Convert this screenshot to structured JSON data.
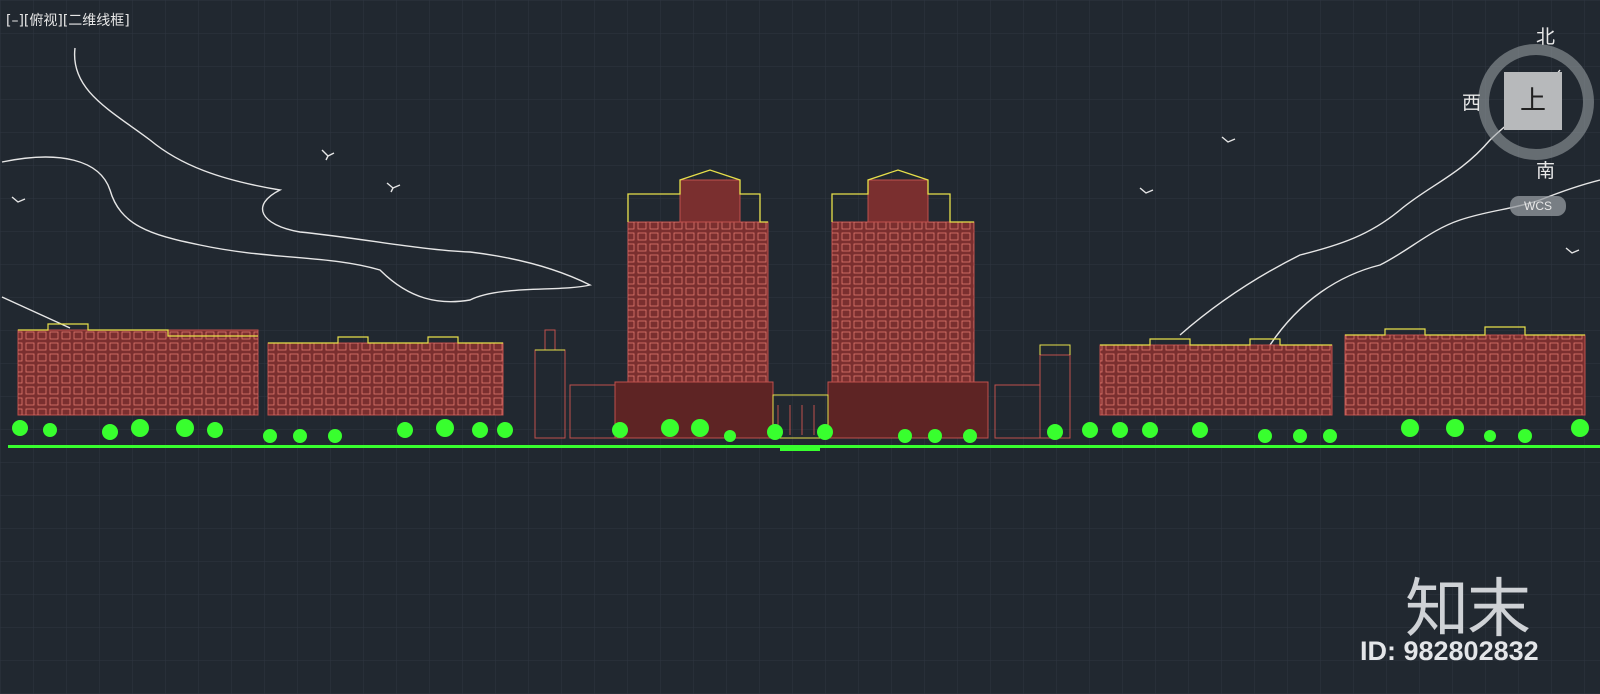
{
  "viewport": {
    "label": "[–][俯视][二维线框]"
  },
  "viewcube": {
    "north": "北",
    "west": "西",
    "south": "南",
    "face": "上",
    "wcs": "WCS"
  },
  "watermark": {
    "brand": "知末",
    "id": "ID: 982802832"
  },
  "colors": {
    "background": "#212830",
    "grid": "#2d3540",
    "building": "#c0504d",
    "roof": "#e8e04a",
    "trees": "#38ff2e",
    "lines": "#e8e8e8"
  }
}
